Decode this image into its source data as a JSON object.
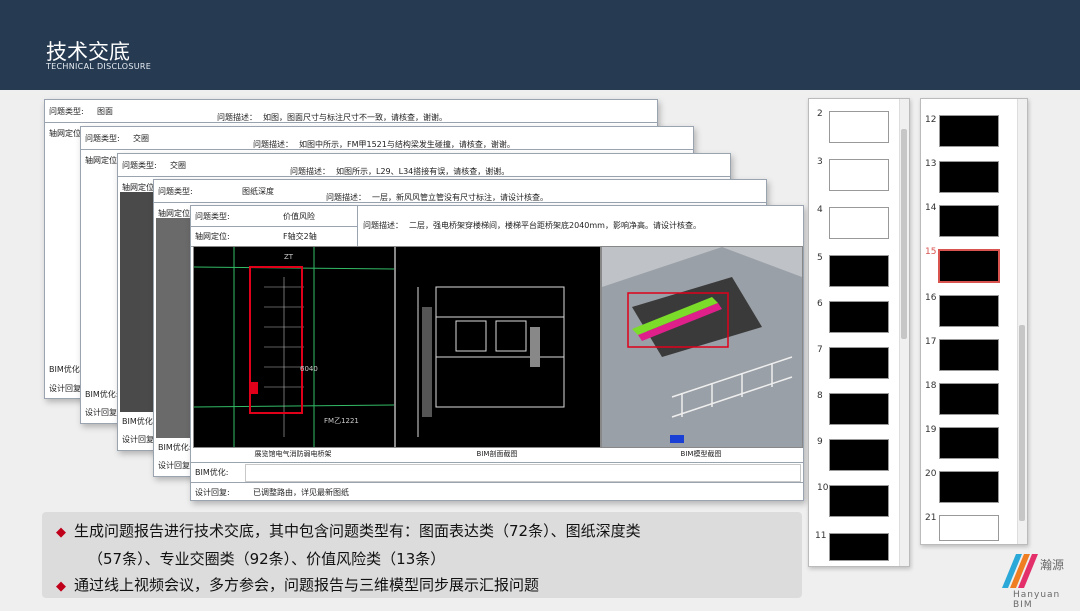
{
  "header": {
    "title": "技术交底",
    "subtitle": "TECHNICAL DISCLOSURE"
  },
  "labels": {
    "issue_type": "问题类型:",
    "axis_position": "轴网定位:",
    "issue_desc": "问题描述：",
    "bim_opt": "BIM优化:",
    "design_reply": "设计回复:"
  },
  "reports": [
    {
      "type": "图面",
      "desc": "如图，图面尺寸与标注尺寸不一致，请核查，谢谢。"
    },
    {
      "type": "交圈",
      "desc": "如图中所示，FM甲1521与结构梁发生碰撞，请核查，谢谢。"
    },
    {
      "type": "交圈",
      "desc": "如图所示，L29、L34搭接有误，请核查，谢谢。"
    },
    {
      "type": "图纸深度",
      "desc": "一层，新风风管立管没有尺寸标注，请设计核查。"
    }
  ],
  "front_report": {
    "type": "价值风险",
    "axis": "F轴交2轴",
    "desc": "二层，强电桥架穿楼梯间，楼梯平台距桥架底2040mm，影响净高。请设计核查。",
    "captions": [
      "展览馆电气消防弱电桥架",
      "BIM剖面截图",
      "BIM模型截图"
    ],
    "bim_opt_value": "",
    "design_reply_value": "已调整路由，详见最新图纸",
    "drawing_texts": [
      "6040",
      "FM乙1221",
      "ZT"
    ]
  },
  "bullets": [
    "生成问题报告进行技术交底，其中包含问题类型有：图面表达类（72条）、图纸深度类",
    "（57条）、专业交圈类（92条）、价值风险类（13条）",
    "通过线上视频会议，多方参会，问题报告与三维模型同步展示汇报问题"
  ],
  "thumbs_left": [
    "2",
    "3",
    "4",
    "5",
    "6",
    "7",
    "8",
    "9",
    "10",
    "11"
  ],
  "thumbs_right": [
    "12",
    "13",
    "14",
    "15",
    "16",
    "17",
    "18",
    "19",
    "20",
    "21"
  ],
  "selected_slide": "15",
  "logo": {
    "cn": "瀚源",
    "en": "Hanyuan  BIM"
  },
  "colors": {
    "header": "#263a52",
    "accent": "#c0001a",
    "highlight": "#e0001a"
  }
}
